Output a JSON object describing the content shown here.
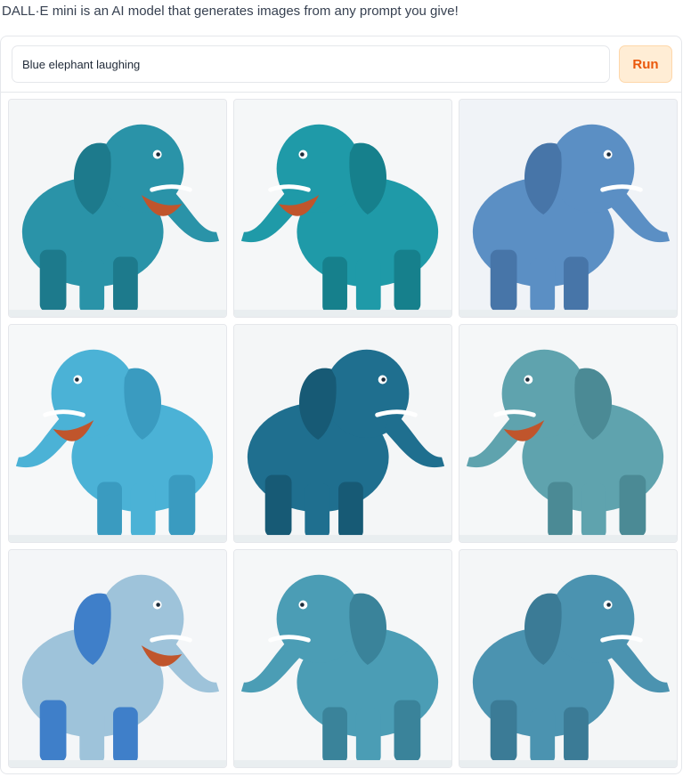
{
  "intro": "DALL·E mini is an AI model that generates images from any prompt you give!",
  "prompt": {
    "value": "Blue elephant laughing",
    "placeholder": ""
  },
  "run_label": "Run",
  "colors": {
    "accent_bg": "#ffedd5",
    "accent_text": "#ea580c",
    "accent_border": "#fed7aa"
  },
  "gallery": {
    "images": [
      {
        "subject": "blue-elephant",
        "body": "#2a93a8",
        "shade": "#1d7a8c",
        "bg": "#f4f6f7",
        "mouth": true
      },
      {
        "subject": "blue-elephant",
        "body": "#1f9aa8",
        "shade": "#16808c",
        "bg": "#f5f7f8",
        "mouth": true
      },
      {
        "subject": "blue-elephant",
        "body": "#5b8fc4",
        "shade": "#4775a8",
        "bg": "#f0f3f7",
        "mouth": false
      },
      {
        "subject": "blue-elephant",
        "body": "#4bb2d6",
        "shade": "#3a9bc0",
        "bg": "#f6f8f9",
        "mouth": true
      },
      {
        "subject": "blue-elephant",
        "body": "#1f6f8f",
        "shade": "#175a75",
        "bg": "#f4f6f7",
        "mouth": false
      },
      {
        "subject": "blue-elephant",
        "body": "#5fa3ae",
        "shade": "#4b8a95",
        "bg": "#f5f7f8",
        "mouth": true
      },
      {
        "subject": "blue-elephant",
        "body": "#9ec3da",
        "shade": "#3f7fc9",
        "bg": "#f4f6f8",
        "mouth": true
      },
      {
        "subject": "blue-elephant",
        "body": "#4b9db5",
        "shade": "#3a839a",
        "bg": "#f5f7f8",
        "mouth": false
      },
      {
        "subject": "blue-elephant",
        "body": "#4b93b0",
        "shade": "#3b7b96",
        "bg": "#f4f6f7",
        "mouth": false
      }
    ]
  }
}
